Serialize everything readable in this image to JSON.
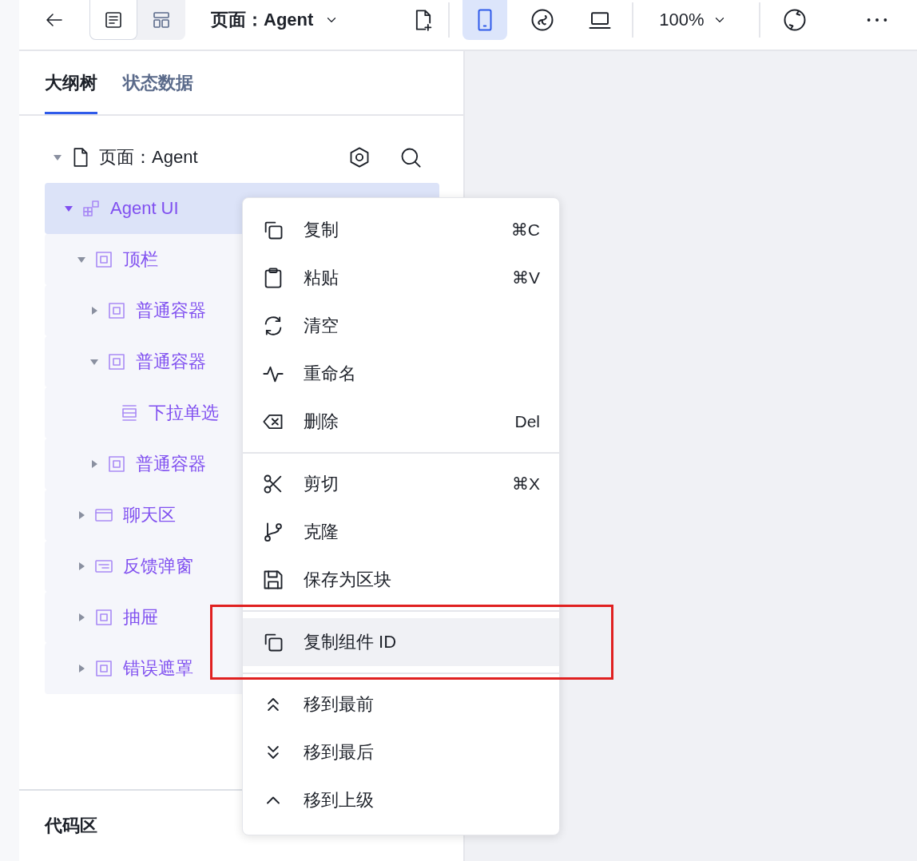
{
  "toolbar": {
    "view_modes": [
      {
        "selected": true
      },
      {
        "selected": false
      }
    ],
    "title": "页面：Agent",
    "devices": [
      {
        "selected": true
      },
      {
        "selected": false
      },
      {
        "selected": false
      }
    ],
    "zoom": "100%"
  },
  "tabs": [
    {
      "label": "大纲树",
      "selected": true
    },
    {
      "label": "状态数据",
      "selected": false
    }
  ],
  "outline": {
    "root": {
      "label": "页面：Agent",
      "expanded": true
    },
    "items": [
      {
        "label": "Agent UI",
        "selected": true,
        "expanded": true,
        "children": [
          {
            "label": "顶栏",
            "selected": false,
            "expanded": true,
            "children": [
              {
                "label": "普通容器",
                "selected": false,
                "expanded": false
              },
              {
                "label": "普通容器",
                "selected": false,
                "expanded": true,
                "children": [
                  {
                    "label": "下拉单选",
                    "selected": false
                  }
                ]
              },
              {
                "label": "普通容器",
                "selected": false,
                "expanded": false
              }
            ]
          },
          {
            "label": "聊天区",
            "selected": false,
            "expanded": false
          },
          {
            "label": "反馈弹窗",
            "selected": false,
            "expanded": false
          },
          {
            "label": "抽屉",
            "selected": false,
            "expanded": false
          },
          {
            "label": "错误遮罩",
            "selected": false,
            "expanded": false
          }
        ]
      }
    ]
  },
  "code_panel": {
    "title": "代码区"
  },
  "context_menu": {
    "sections": [
      [
        {
          "label": "复制",
          "shortcut": "⌘C",
          "highlighted": false
        },
        {
          "label": "粘贴",
          "shortcut": "⌘V",
          "highlighted": false
        },
        {
          "label": "清空",
          "highlighted": false
        },
        {
          "label": "重命名",
          "highlighted": false
        },
        {
          "label": "删除",
          "shortcut": "Del",
          "highlighted": false
        }
      ],
      [
        {
          "label": "剪切",
          "shortcut": "⌘X",
          "highlighted": false
        },
        {
          "label": "克隆",
          "highlighted": false
        },
        {
          "label": "保存为区块",
          "highlighted": false
        }
      ],
      [
        {
          "label": "复制组件 ID",
          "highlighted": true
        }
      ],
      [
        {
          "label": "移到最前",
          "highlighted": false
        },
        {
          "label": "移到最后",
          "highlighted": false
        },
        {
          "label": "移到上级",
          "highlighted": false
        }
      ]
    ]
  }
}
